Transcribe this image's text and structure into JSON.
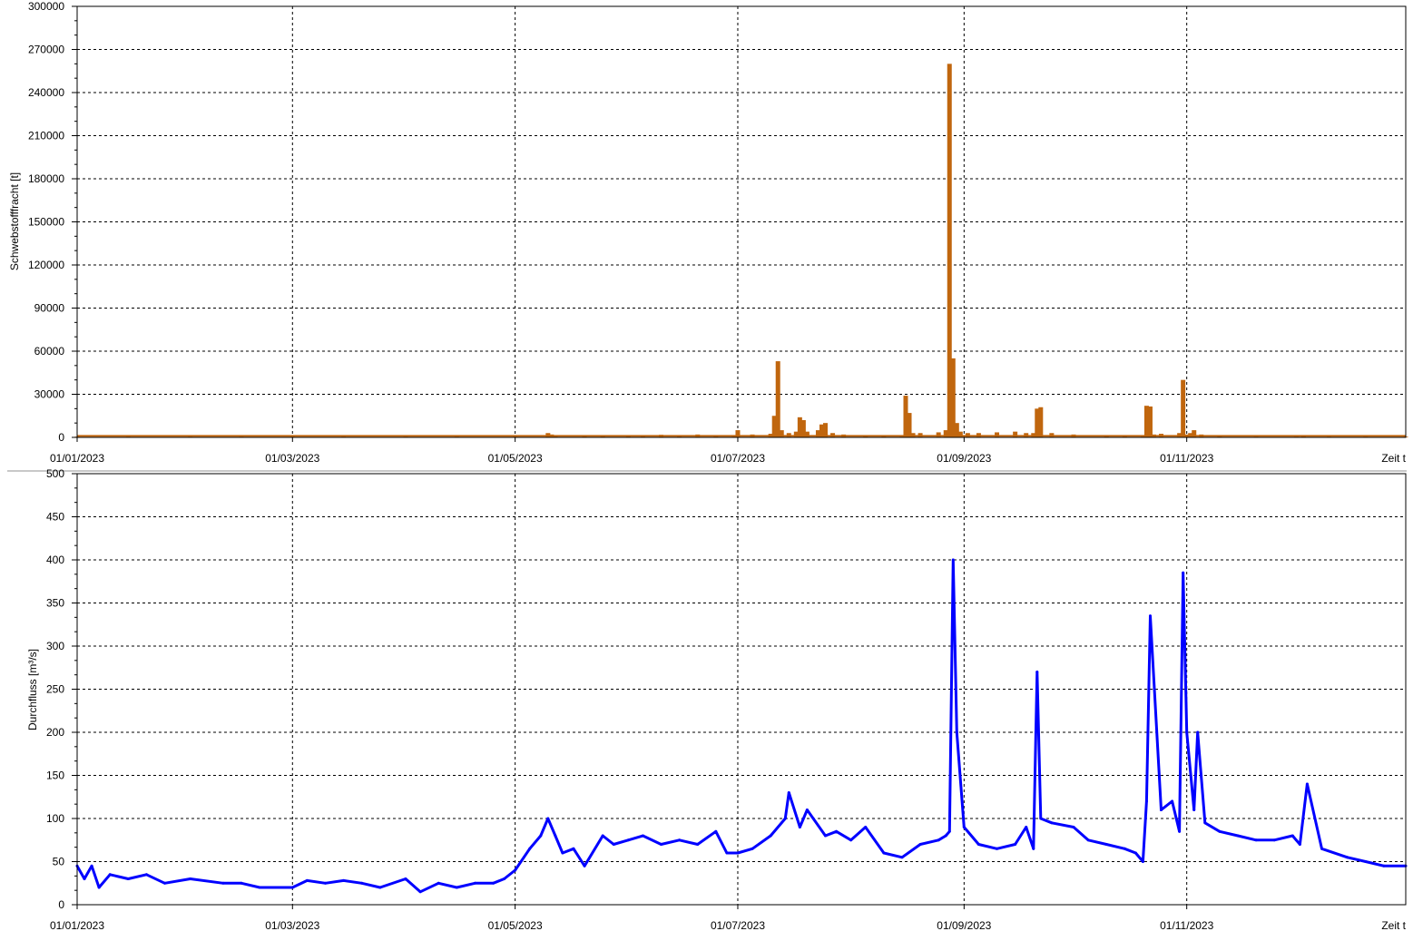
{
  "colors": {
    "sediment": "#C0660E",
    "discharge": "#0000FF",
    "grid": "#000000",
    "separator": "#C8C8C8"
  },
  "charts": [
    {
      "ylabel": "Schwebstofffracht [t]",
      "xlabel": "Zeit t",
      "yticks": [
        "0",
        "30000",
        "60000",
        "90000",
        "120000",
        "150000",
        "180000",
        "210000",
        "240000",
        "270000",
        "300000"
      ],
      "xticks": [
        "01/01/2023",
        "01/03/2023",
        "01/05/2023",
        "01/07/2023",
        "01/09/2023",
        "01/11/2023"
      ]
    },
    {
      "ylabel": "Durchfluss [m³/s]",
      "xlabel": "Zeit t",
      "yticks": [
        "0",
        "50",
        "100",
        "150",
        "200",
        "250",
        "300",
        "350",
        "400",
        "450",
        "500"
      ],
      "xticks": [
        "01/01/2023",
        "01/03/2023",
        "01/05/2023",
        "01/07/2023",
        "01/09/2023",
        "01/11/2023"
      ]
    }
  ],
  "chart_data": [
    {
      "type": "bar",
      "ylabel": "Schwebstofffracht [t]",
      "xlabel": "Zeit t",
      "xlim": [
        "2023-01-01",
        "2023-12-31"
      ],
      "ylim": [
        0,
        300000
      ],
      "grid": true,
      "series": [
        {
          "color": "#C0660E",
          "x": [
            "2023-01-01",
            "2023-01-15",
            "2023-02-01",
            "2023-02-15",
            "2023-03-01",
            "2023-03-15",
            "2023-04-01",
            "2023-04-15",
            "2023-05-01",
            "2023-05-10",
            "2023-05-11",
            "2023-05-12",
            "2023-05-20",
            "2023-05-25",
            "2023-06-01",
            "2023-06-05",
            "2023-06-10",
            "2023-06-15",
            "2023-06-20",
            "2023-06-25",
            "2023-06-30",
            "2023-07-01",
            "2023-07-05",
            "2023-07-10",
            "2023-07-11",
            "2023-07-12",
            "2023-07-13",
            "2023-07-15",
            "2023-07-17",
            "2023-07-18",
            "2023-07-19",
            "2023-07-20",
            "2023-07-23",
            "2023-07-24",
            "2023-07-25",
            "2023-07-27",
            "2023-07-30",
            "2023-08-05",
            "2023-08-10",
            "2023-08-15",
            "2023-08-16",
            "2023-08-17",
            "2023-08-18",
            "2023-08-20",
            "2023-08-25",
            "2023-08-27",
            "2023-08-28",
            "2023-08-29",
            "2023-08-30",
            "2023-08-31",
            "2023-09-02",
            "2023-09-05",
            "2023-09-10",
            "2023-09-15",
            "2023-09-18",
            "2023-09-20",
            "2023-09-21",
            "2023-09-22",
            "2023-09-25",
            "2023-10-01",
            "2023-10-10",
            "2023-10-15",
            "2023-10-20",
            "2023-10-21",
            "2023-10-22",
            "2023-10-23",
            "2023-10-25",
            "2023-10-30",
            "2023-10-31",
            "2023-11-01",
            "2023-11-02",
            "2023-11-03",
            "2023-11-05",
            "2023-11-10",
            "2023-11-20",
            "2023-12-01",
            "2023-12-03",
            "2023-12-10",
            "2023-12-20",
            "2023-12-31"
          ],
          "values": [
            500,
            500,
            500,
            500,
            500,
            500,
            500,
            500,
            500,
            3000,
            2000,
            1000,
            800,
            800,
            1000,
            1200,
            1800,
            1500,
            2000,
            1500,
            1500,
            5000,
            2000,
            2500,
            15000,
            53000,
            5000,
            3000,
            4000,
            14000,
            12000,
            4000,
            5000,
            9000,
            10000,
            3000,
            2000,
            1000,
            1000,
            1500,
            29000,
            17000,
            3000,
            3000,
            3500,
            5000,
            260000,
            55000,
            10000,
            4000,
            3000,
            3000,
            3500,
            4000,
            3000,
            3000,
            20000,
            21000,
            3000,
            2000,
            1500,
            1500,
            1000,
            22000,
            21500,
            2000,
            2500,
            3000,
            40000,
            2000,
            3000,
            5000,
            2000,
            1000,
            500,
            500,
            1500,
            500,
            500,
            500
          ]
        }
      ]
    },
    {
      "type": "line",
      "ylabel": "Durchfluss [m³/s]",
      "xlabel": "Zeit t",
      "xlim": [
        "2023-01-01",
        "2023-12-31"
      ],
      "ylim": [
        0,
        500
      ],
      "grid": true,
      "series": [
        {
          "color": "#0000FF",
          "x": [
            "2023-01-01",
            "2023-01-03",
            "2023-01-05",
            "2023-01-07",
            "2023-01-10",
            "2023-01-15",
            "2023-01-20",
            "2023-01-25",
            "2023-02-01",
            "2023-02-10",
            "2023-02-15",
            "2023-02-20",
            "2023-02-25",
            "2023-03-01",
            "2023-03-05",
            "2023-03-10",
            "2023-03-15",
            "2023-03-20",
            "2023-03-25",
            "2023-04-01",
            "2023-04-05",
            "2023-04-10",
            "2023-04-15",
            "2023-04-20",
            "2023-04-25",
            "2023-04-28",
            "2023-05-01",
            "2023-05-05",
            "2023-05-08",
            "2023-05-10",
            "2023-05-12",
            "2023-05-14",
            "2023-05-17",
            "2023-05-20",
            "2023-05-25",
            "2023-05-28",
            "2023-06-01",
            "2023-06-05",
            "2023-06-10",
            "2023-06-15",
            "2023-06-20",
            "2023-06-25",
            "2023-06-28",
            "2023-07-01",
            "2023-07-05",
            "2023-07-10",
            "2023-07-14",
            "2023-07-15",
            "2023-07-18",
            "2023-07-20",
            "2023-07-25",
            "2023-07-28",
            "2023-08-01",
            "2023-08-05",
            "2023-08-10",
            "2023-08-15",
            "2023-08-20",
            "2023-08-25",
            "2023-08-27",
            "2023-08-28",
            "2023-08-29",
            "2023-08-30",
            "2023-09-01",
            "2023-09-05",
            "2023-09-10",
            "2023-09-15",
            "2023-09-18",
            "2023-09-20",
            "2023-09-21",
            "2023-09-22",
            "2023-09-25",
            "2023-10-01",
            "2023-10-05",
            "2023-10-10",
            "2023-10-15",
            "2023-10-18",
            "2023-10-20",
            "2023-10-21",
            "2023-10-22",
            "2023-10-25",
            "2023-10-28",
            "2023-10-30",
            "2023-10-31",
            "2023-11-01",
            "2023-11-03",
            "2023-11-04",
            "2023-11-06",
            "2023-11-10",
            "2023-11-15",
            "2023-11-20",
            "2023-11-25",
            "2023-11-30",
            "2023-12-01",
            "2023-12-02",
            "2023-12-04",
            "2023-12-08",
            "2023-12-15",
            "2023-12-20",
            "2023-12-25",
            "2023-12-31"
          ],
          "values": [
            45,
            30,
            45,
            20,
            35,
            30,
            35,
            25,
            30,
            25,
            25,
            20,
            20,
            20,
            28,
            25,
            28,
            25,
            20,
            30,
            15,
            25,
            20,
            25,
            25,
            30,
            40,
            65,
            80,
            100,
            80,
            60,
            65,
            45,
            80,
            70,
            75,
            80,
            70,
            75,
            70,
            85,
            60,
            60,
            65,
            80,
            100,
            130,
            90,
            110,
            80,
            85,
            75,
            90,
            60,
            55,
            70,
            75,
            80,
            85,
            400,
            200,
            90,
            70,
            65,
            70,
            90,
            65,
            270,
            100,
            95,
            90,
            75,
            70,
            65,
            60,
            50,
            120,
            335,
            110,
            120,
            85,
            385,
            200,
            110,
            200,
            95,
            85,
            80,
            75,
            75,
            80,
            75,
            70,
            140,
            65,
            55,
            50,
            45,
            45
          ]
        }
      ]
    }
  ]
}
